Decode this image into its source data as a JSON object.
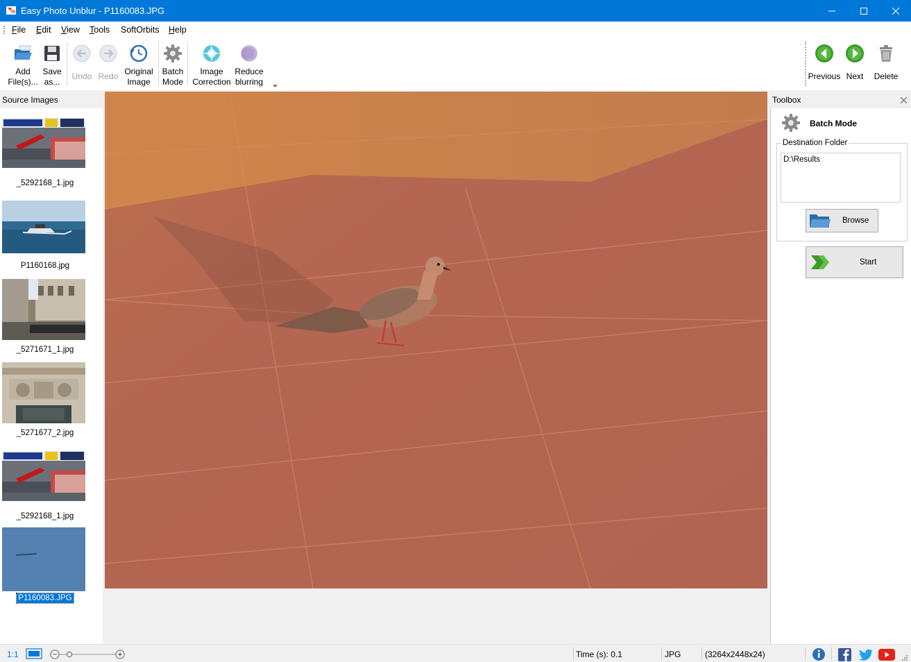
{
  "window": {
    "title": "Easy Photo Unblur - P1160083.JPG"
  },
  "menu": [
    "File",
    "Edit",
    "View",
    "Tools",
    "SoftOrbits",
    "Help"
  ],
  "ribbon": {
    "add": "Add\nFile(s)...",
    "save": "Save\nas...",
    "undo": "Undo",
    "redo": "Redo",
    "original": "Original\nImage",
    "batch": "Batch\nMode",
    "correction": "Image\nCorrection",
    "reduce": "Reduce\nblurring",
    "previous": "Previous",
    "next": "Next",
    "delete": "Delete"
  },
  "source_panel": {
    "title": "Source Images",
    "items": [
      {
        "name": "_5292168_1.jpg"
      },
      {
        "name": "P1160168.jpg"
      },
      {
        "name": "_5271671_1.jpg"
      },
      {
        "name": "_5271677_2.jpg"
      },
      {
        "name": "_5292168_1.jpg"
      },
      {
        "name": "P1160083.JPG",
        "selected": true
      }
    ]
  },
  "toolbox": {
    "title": "Toolbox",
    "mode_title": "Batch Mode",
    "dest_label": "Destination Folder",
    "dest_value": "D:\\Results",
    "browse": "Browse",
    "start": "Start"
  },
  "status": {
    "zoom_ratio": "1:1",
    "time": "Time (s): 0.1",
    "format": "JPG",
    "dims": "(3264x2448x24)"
  },
  "colors": {
    "accent": "#0078d7",
    "titlebar": "#0078d7",
    "nav_green": "#3a9a2a"
  }
}
